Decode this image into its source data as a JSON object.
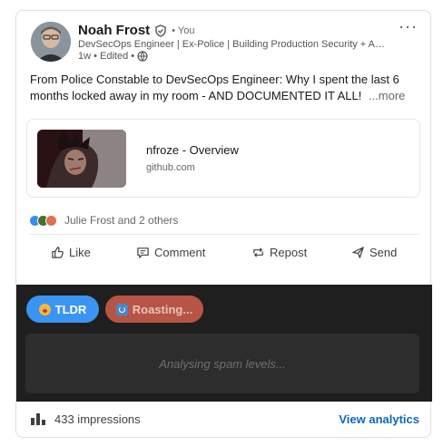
{
  "author": {
    "name": "Noah Frost",
    "degree": "• You",
    "headline": "DevSecOps Engineer | Ex-Police | Building Production Security + AI A...",
    "meta": "1w • Edited •"
  },
  "post": {
    "text": "From Police Constable to DevSecOps Engineer: Why I spent the last 6 months locked away in my room - AND DOCUMENTED IT ALL!",
    "see_more": "...more"
  },
  "link_preview": {
    "title": "nfroze - Overview",
    "domain": "github.com"
  },
  "social": {
    "reactions_text": "Julie Frost and 2 others",
    "reaction_types": [
      "like",
      "celebrate",
      "love"
    ]
  },
  "actions": {
    "like": "Like",
    "comment": "Comment",
    "repost": "Repost",
    "send": "Send"
  },
  "ai_panel": {
    "tldr_label": "TLDR",
    "roast_label": "Roasting...",
    "analysis_text": "Analysing spam levels..."
  },
  "footer": {
    "impressions": "433 impressions",
    "view_analytics": "View analytics"
  },
  "colors": {
    "brand_blue": "#0a66c2",
    "tldr_blue": "#3a95f2",
    "roast_red": "#b65546",
    "panel_dark": "#1f1f1f"
  }
}
